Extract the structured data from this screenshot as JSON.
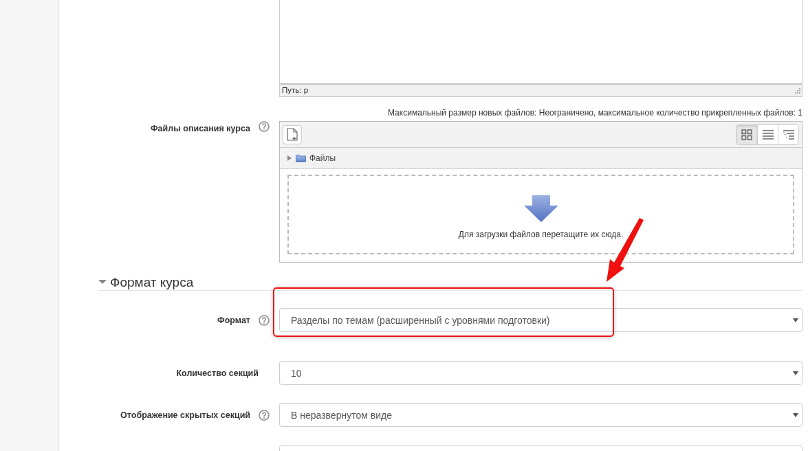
{
  "editor": {
    "path_label": "Путь: p"
  },
  "files_field": {
    "label": "Файлы описания курса",
    "help": true,
    "limits": "Максимальный размер новых файлов: Неограничено, максимальное количество прикрепленных файлов: 1",
    "folder": "Файлы",
    "folder_expanded": false,
    "drop_hint": "Для загрузки файлов перетащите их сюда.",
    "views": [
      {
        "kind": "icons",
        "selected": true
      },
      {
        "kind": "list",
        "selected": false
      },
      {
        "kind": "tree",
        "selected": false
      }
    ]
  },
  "section": {
    "title": "Формат курса",
    "expanded": true
  },
  "fields": [
    {
      "label": "Формат",
      "help": true,
      "value": "Разделы по темам (расширенный с уровнями подготовки)",
      "highlighted": true
    },
    {
      "label": "Количество секций",
      "help": false,
      "value": "10",
      "highlighted": false
    },
    {
      "label": "Отображение скрытых секций",
      "help": true,
      "value": "В неразвернутом виде",
      "highlighted": false
    }
  ]
}
